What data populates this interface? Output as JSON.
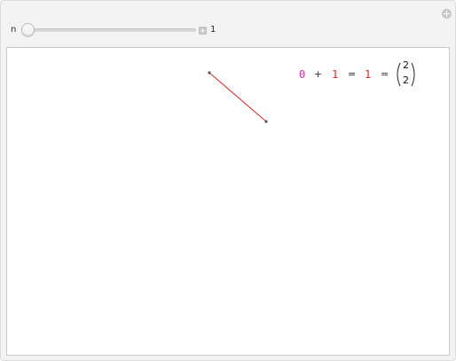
{
  "controls": {
    "label": "n",
    "slider_value": "1",
    "slider_fraction": 0.0
  },
  "equation": {
    "term1": "0",
    "plus": "+",
    "term2": "1",
    "eq1": "=",
    "term3": "1",
    "eq2": "=",
    "binomial_top": "2",
    "binomial_bottom": "2"
  },
  "colors": {
    "segment": "#e2241b",
    "magenta": "#d62fa3",
    "red": "#e2241b"
  }
}
